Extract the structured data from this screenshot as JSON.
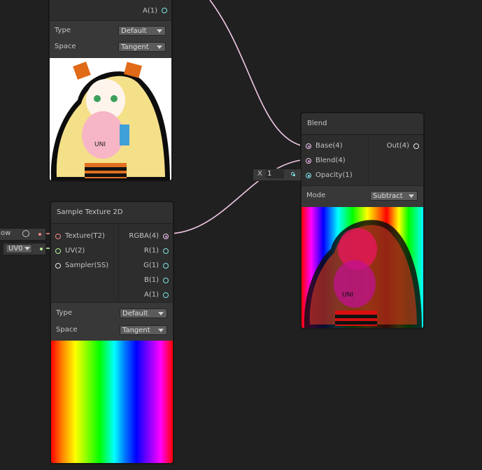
{
  "top_node": {
    "port_a": "A(1)",
    "type_label": "Type",
    "type_value": "Default",
    "space_label": "Space",
    "space_value": "Tangent",
    "preview_caption": "UNI"
  },
  "blend_node": {
    "title": "Blend",
    "inputs": [
      "Base(4)",
      "Blend(4)",
      "Opacity(1)"
    ],
    "output": "Out(4)",
    "mode_label": "Mode",
    "mode_value": "Subtract",
    "preview_caption": "UNI"
  },
  "opacity_field": {
    "axis": "X",
    "value": "1"
  },
  "sample_node": {
    "title": "Sample Texture 2D",
    "inputs": [
      "Texture(T2)",
      "UV(2)",
      "Sampler(SS)"
    ],
    "outputs": [
      "RGBA(4)",
      "R(1)",
      "G(1)",
      "B(1)",
      "A(1)"
    ],
    "type_label": "Type",
    "type_value": "Default",
    "space_label": "Space",
    "space_value": "Tangent"
  },
  "left_inputs": {
    "texture_value": "ow",
    "uv_value": "UV0"
  },
  "colors": {
    "background": "#202020",
    "node": "#393939",
    "wire_vector4": "#f2c8e6",
    "wire_float": "#7fe3e8",
    "wire_vector2": "#b7f09a",
    "wire_texture": "#f08a82"
  }
}
